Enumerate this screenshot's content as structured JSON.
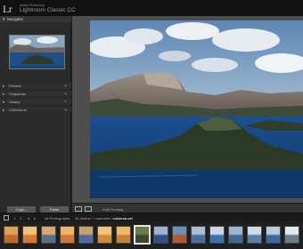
{
  "app": {
    "logo": "Lr",
    "vendor": "Adobe Photoshop",
    "name": "Lightroom Classic CC"
  },
  "left_panel": {
    "navigator_label": "Navigator",
    "panels": [
      {
        "label": "Presets"
      },
      {
        "label": "Snapshots"
      },
      {
        "label": "History"
      },
      {
        "label": "Collections"
      }
    ],
    "copy_button": "Copy...",
    "paste_button": "Paste"
  },
  "toolbar": {
    "soft_proofing": "Soft Proofing"
  },
  "filmstrip_bar": {
    "page1": "1",
    "page2": "2",
    "source": "All Photographs",
    "count_prefix": "44 photos / 1 selected /",
    "filename": "crateroa.orf"
  },
  "colors": {
    "background": "#1e1e1e",
    "panel": "#2b2b2b",
    "panel_header": "#353535",
    "main_view": "#4e4e4e",
    "topbar": "#111111",
    "selected_thumb": "#e3e3e3"
  },
  "filmstrip": {
    "thumb_count": 16,
    "selected_index": 7
  }
}
